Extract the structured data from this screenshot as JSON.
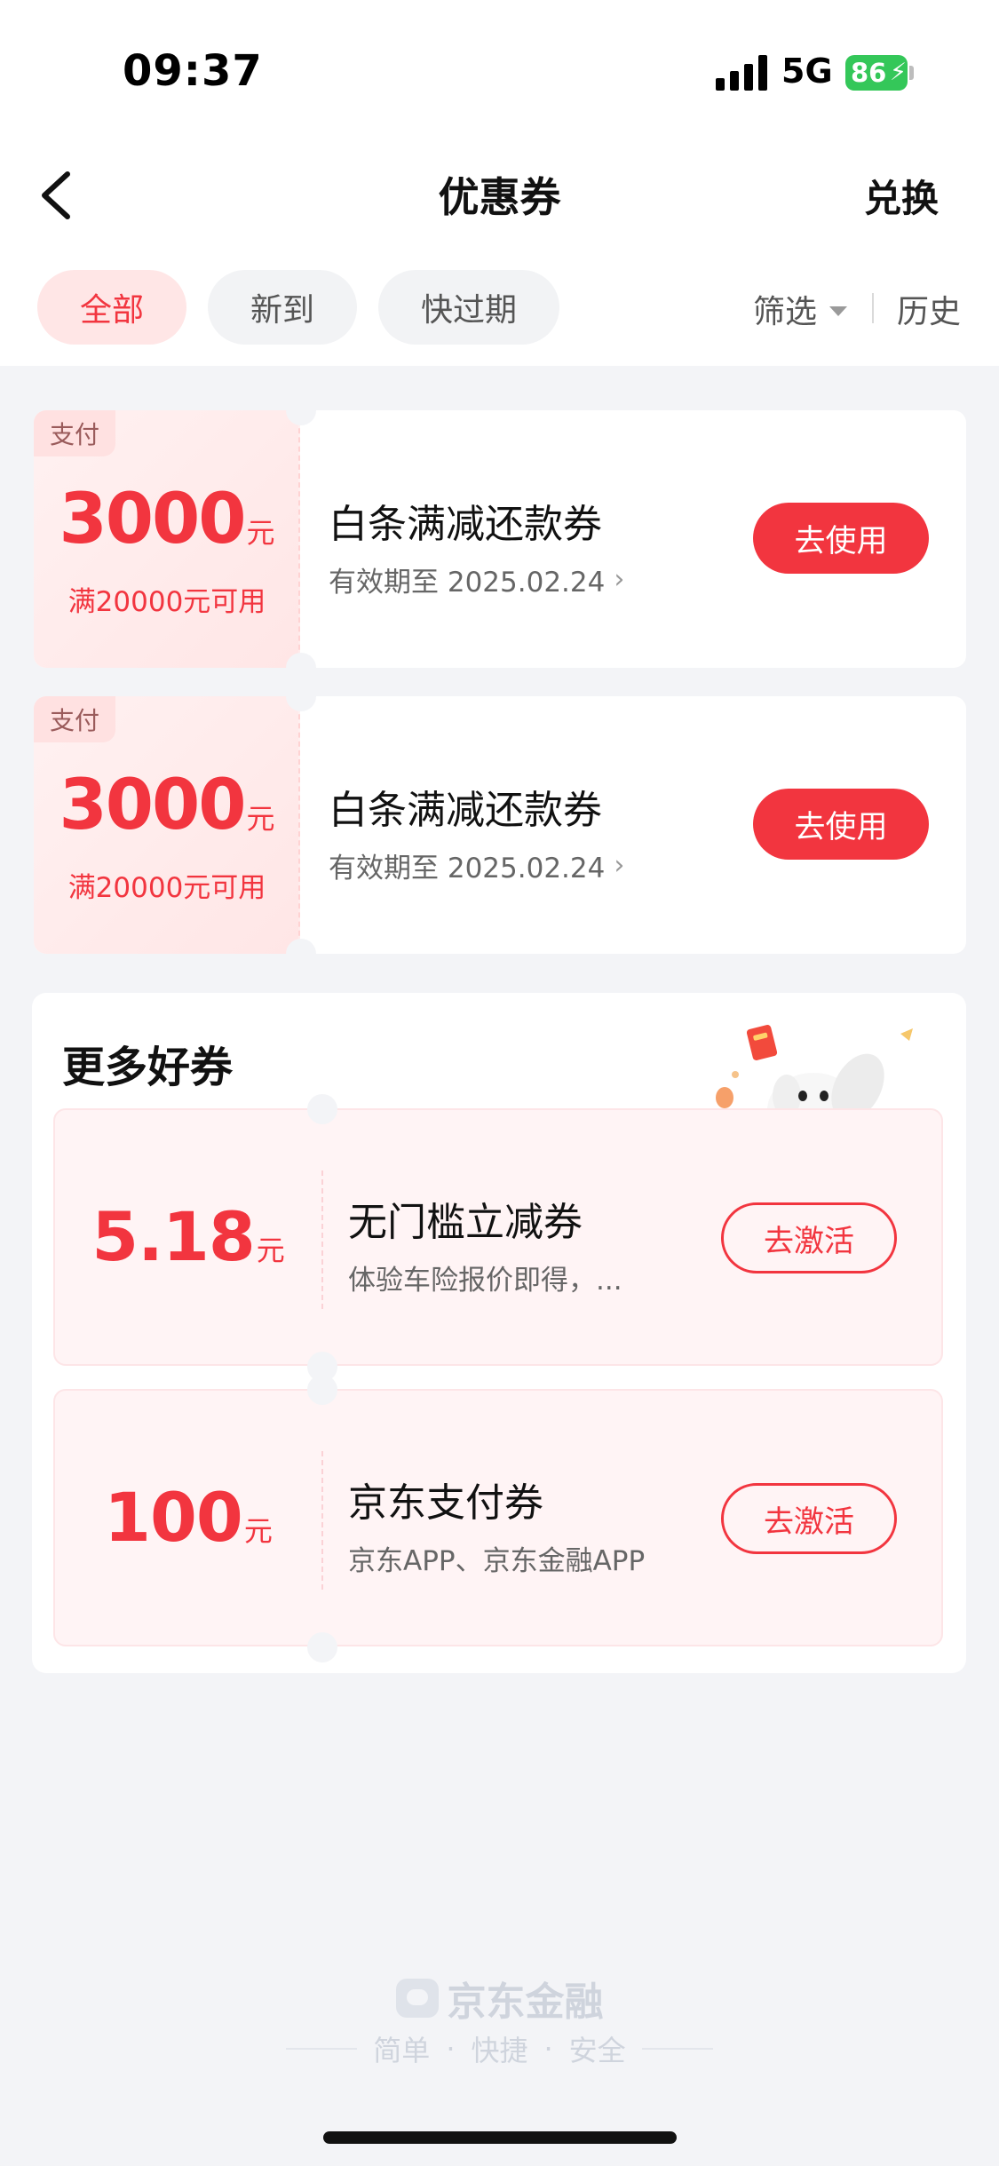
{
  "status_bar": {
    "time": "09:37",
    "network": "5G",
    "battery": "86"
  },
  "header": {
    "title": "优惠券",
    "exchange_label": "兑换"
  },
  "filter_tabs": [
    {
      "label": "全部",
      "active": true
    },
    {
      "label": "新到",
      "active": false
    },
    {
      "label": "快过期",
      "active": false
    }
  ],
  "filter_label": "筛选",
  "history_label": "历史",
  "coupons": [
    {
      "tag": "支付",
      "amount": "3000",
      "unit": "元",
      "condition": "满20000元可用",
      "name": "白条满减还款券",
      "validity": "有效期至 2025.02.24",
      "button": "去使用"
    },
    {
      "tag": "支付",
      "amount": "3000",
      "unit": "元",
      "condition": "满20000元可用",
      "name": "白条满减还款券",
      "validity": "有效期至 2025.02.24",
      "button": "去使用"
    }
  ],
  "more_coupons": {
    "title": "更多好券",
    "items": [
      {
        "amount": "5.18",
        "unit": "元",
        "name": "无门槛立减券",
        "desc": "体验车险报价即得，...",
        "button": "去激活"
      },
      {
        "amount": "100",
        "unit": "元",
        "name": "京东支付券",
        "desc": "京东APP、京东金融APP",
        "button": "去激活"
      }
    ]
  },
  "footer": {
    "brand": "京东金融",
    "slogan_parts": [
      "简单",
      "快捷",
      "安全"
    ]
  },
  "colors": {
    "accent": "#f2353f",
    "background": "#f3f4f7",
    "battery": "#34c759"
  }
}
